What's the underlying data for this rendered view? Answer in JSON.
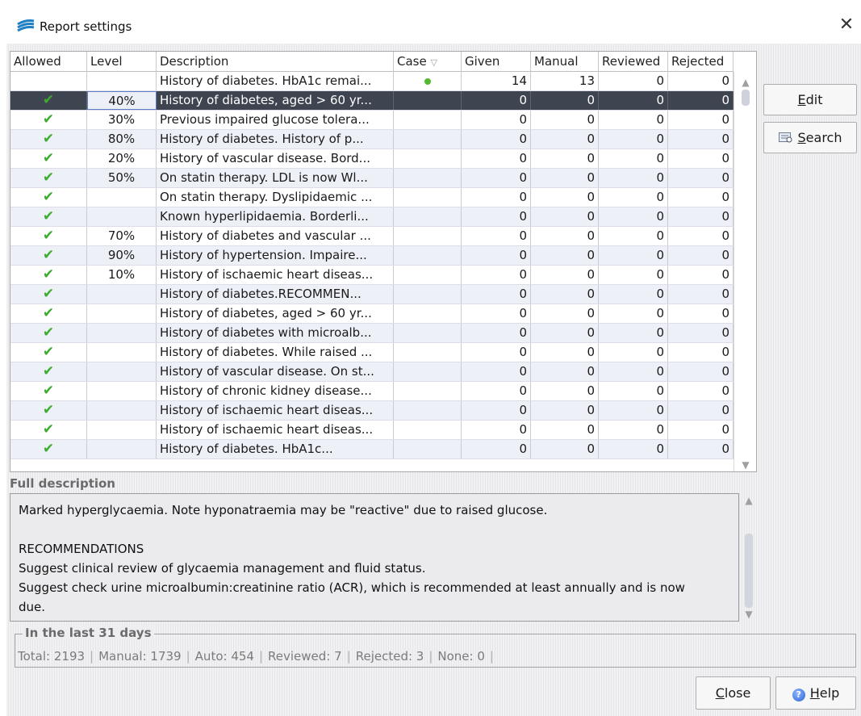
{
  "window": {
    "title": "Report settings",
    "close_glyph": "✕",
    "icon": "app-logo-icon"
  },
  "table": {
    "columns": [
      "Allowed",
      "Level",
      "Description",
      "Case",
      "Given",
      "Manual",
      "Reviewed",
      "Rejected"
    ],
    "case_sort_glyph": "▽",
    "check_glyph": "✔",
    "rows": [
      {
        "allowed": "",
        "level": "",
        "description": "History of diabetes. HbA1c remai...",
        "case": "dot",
        "given": "14",
        "manual": "13",
        "reviewed": "0",
        "rejected": "0"
      },
      {
        "allowed": "✔",
        "level": "40%",
        "description": "History of diabetes, aged > 60 yr...",
        "case": "",
        "given": "0",
        "manual": "0",
        "reviewed": "0",
        "rejected": "0",
        "selected": true
      },
      {
        "allowed": "✔",
        "level": "30%",
        "description": "Previous impaired glucose tolera...",
        "case": "",
        "given": "0",
        "manual": "0",
        "reviewed": "0",
        "rejected": "0"
      },
      {
        "allowed": "✔",
        "level": "80%",
        "description": "History of diabetes. History of p...",
        "case": "",
        "given": "0",
        "manual": "0",
        "reviewed": "0",
        "rejected": "0"
      },
      {
        "allowed": "✔",
        "level": "20%",
        "description": "History of vascular disease. Bord...",
        "case": "",
        "given": "0",
        "manual": "0",
        "reviewed": "0",
        "rejected": "0"
      },
      {
        "allowed": "✔",
        "level": "50%",
        "description": "On statin therapy. LDL is now Wl...",
        "case": "",
        "given": "0",
        "manual": "0",
        "reviewed": "0",
        "rejected": "0"
      },
      {
        "allowed": "✔",
        "level": "",
        "description": "On statin therapy. Dyslipidaemic ...",
        "case": "",
        "given": "0",
        "manual": "0",
        "reviewed": "0",
        "rejected": "0"
      },
      {
        "allowed": "✔",
        "level": "",
        "description": "Known hyperlipidaemia. Borderli...",
        "case": "",
        "given": "0",
        "manual": "0",
        "reviewed": "0",
        "rejected": "0"
      },
      {
        "allowed": "✔",
        "level": "70%",
        "description": "History of diabetes and vascular ...",
        "case": "",
        "given": "0",
        "manual": "0",
        "reviewed": "0",
        "rejected": "0"
      },
      {
        "allowed": "✔",
        "level": "90%",
        "description": "History of hypertension. Impaire...",
        "case": "",
        "given": "0",
        "manual": "0",
        "reviewed": "0",
        "rejected": "0"
      },
      {
        "allowed": "✔",
        "level": "10%",
        "description": "History of ischaemic heart diseas...",
        "case": "",
        "given": "0",
        "manual": "0",
        "reviewed": "0",
        "rejected": "0"
      },
      {
        "allowed": "✔",
        "level": "",
        "description": "History of diabetes.RECOMMEN...",
        "case": "",
        "given": "0",
        "manual": "0",
        "reviewed": "0",
        "rejected": "0"
      },
      {
        "allowed": "✔",
        "level": "",
        "description": "History of diabetes, aged > 60 yr...",
        "case": "",
        "given": "0",
        "manual": "0",
        "reviewed": "0",
        "rejected": "0"
      },
      {
        "allowed": "✔",
        "level": "",
        "description": "History of diabetes with microalb...",
        "case": "",
        "given": "0",
        "manual": "0",
        "reviewed": "0",
        "rejected": "0"
      },
      {
        "allowed": "✔",
        "level": "",
        "description": "History of diabetes. While raised ...",
        "case": "",
        "given": "0",
        "manual": "0",
        "reviewed": "0",
        "rejected": "0"
      },
      {
        "allowed": "✔",
        "level": "",
        "description": "History of vascular disease. On st...",
        "case": "",
        "given": "0",
        "manual": "0",
        "reviewed": "0",
        "rejected": "0"
      },
      {
        "allowed": "✔",
        "level": "",
        "description": "History of chronic kidney disease...",
        "case": "",
        "given": "0",
        "manual": "0",
        "reviewed": "0",
        "rejected": "0"
      },
      {
        "allowed": "✔",
        "level": "",
        "description": "History of ischaemic heart diseas...",
        "case": "",
        "given": "0",
        "manual": "0",
        "reviewed": "0",
        "rejected": "0"
      },
      {
        "allowed": "✔",
        "level": "",
        "description": "History of ischaemic heart diseas...",
        "case": "",
        "given": "0",
        "manual": "0",
        "reviewed": "0",
        "rejected": "0"
      },
      {
        "allowed": "✔",
        "level": "",
        "description": "History of diabetes. HbA1c...",
        "case": "",
        "given": "0",
        "manual": "0",
        "reviewed": "0",
        "rejected": "0"
      }
    ]
  },
  "buttons": {
    "edit": {
      "underline": "E",
      "rest": "dit"
    },
    "search": {
      "underline": "S",
      "rest": "earch"
    },
    "close": {
      "underline": "C",
      "rest": "lose"
    },
    "help": {
      "underline": "H",
      "rest": "elp",
      "glyph": "?"
    }
  },
  "full_description": {
    "label": "Full description",
    "lines": [
      "Marked hyperglycaemia. Note hyponatraemia may be \"reactive\" due to raised glucose.",
      "",
      "RECOMMENDATIONS",
      "Suggest clinical review of glycaemia management and fluid status.",
      "Suggest check urine microalbumin:creatinine ratio (ACR), which is recommended at least annually and is now",
      "due."
    ]
  },
  "stats": {
    "title": "In the last 31 days",
    "items": [
      "Total: 2193",
      "Manual: 1739",
      "Auto: 454",
      "Reviewed: 7",
      "Rejected: 3",
      "None: 0"
    ],
    "separator": "|"
  },
  "colors": {
    "check": "#3cab2f",
    "case_dot": "#53b932",
    "selected_row": "#3f4451",
    "alt_row": "#eef0f8"
  }
}
